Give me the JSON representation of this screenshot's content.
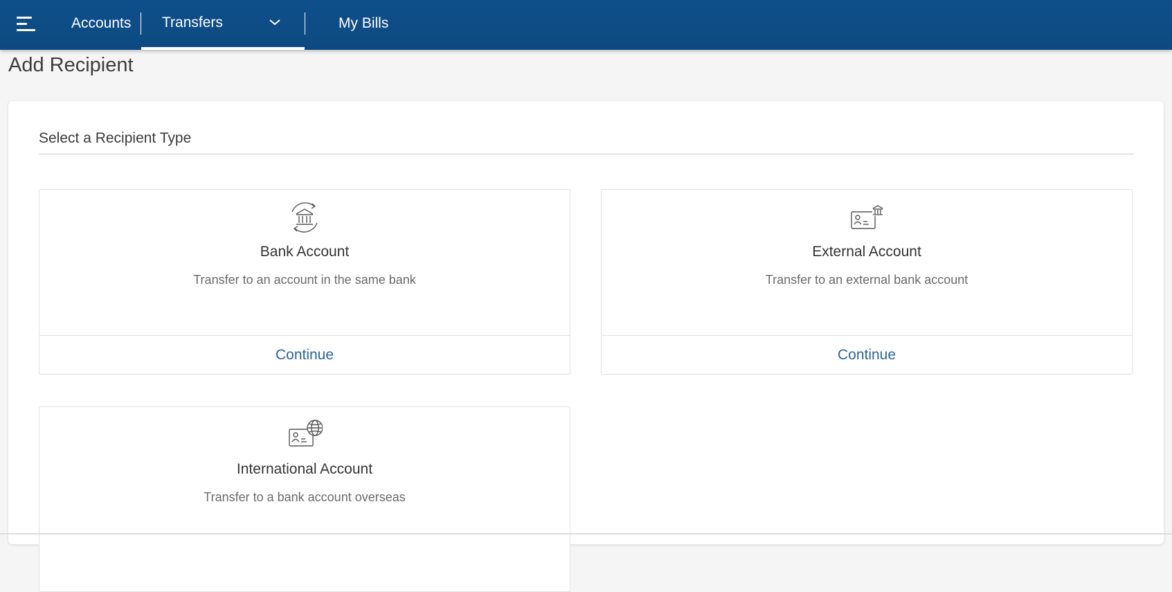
{
  "nav": {
    "menu_icon": "hamburger-menu-icon",
    "items": [
      {
        "label": "Accounts"
      },
      {
        "label": "Transfers",
        "active": true
      },
      {
        "label": "My Bills"
      }
    ],
    "dropdown_icon": "chevron-down-icon"
  },
  "page": {
    "title": "Add Recipient"
  },
  "section": {
    "heading": "Select a Recipient Type"
  },
  "cards": [
    {
      "icon": "bank-transfer-icon",
      "title": "Bank Account",
      "description": "Transfer to an account in the same bank",
      "action": "Continue"
    },
    {
      "icon": "id-card-bank-icon",
      "title": "External Account",
      "description": "Transfer to an external bank account",
      "action": "Continue"
    },
    {
      "icon": "id-card-globe-icon",
      "title": "International Account",
      "description": "Transfer to a bank account overseas"
    }
  ],
  "colors": {
    "header": "#0e4f8a",
    "link": "#2a6496",
    "background": "#f5f5f5"
  }
}
